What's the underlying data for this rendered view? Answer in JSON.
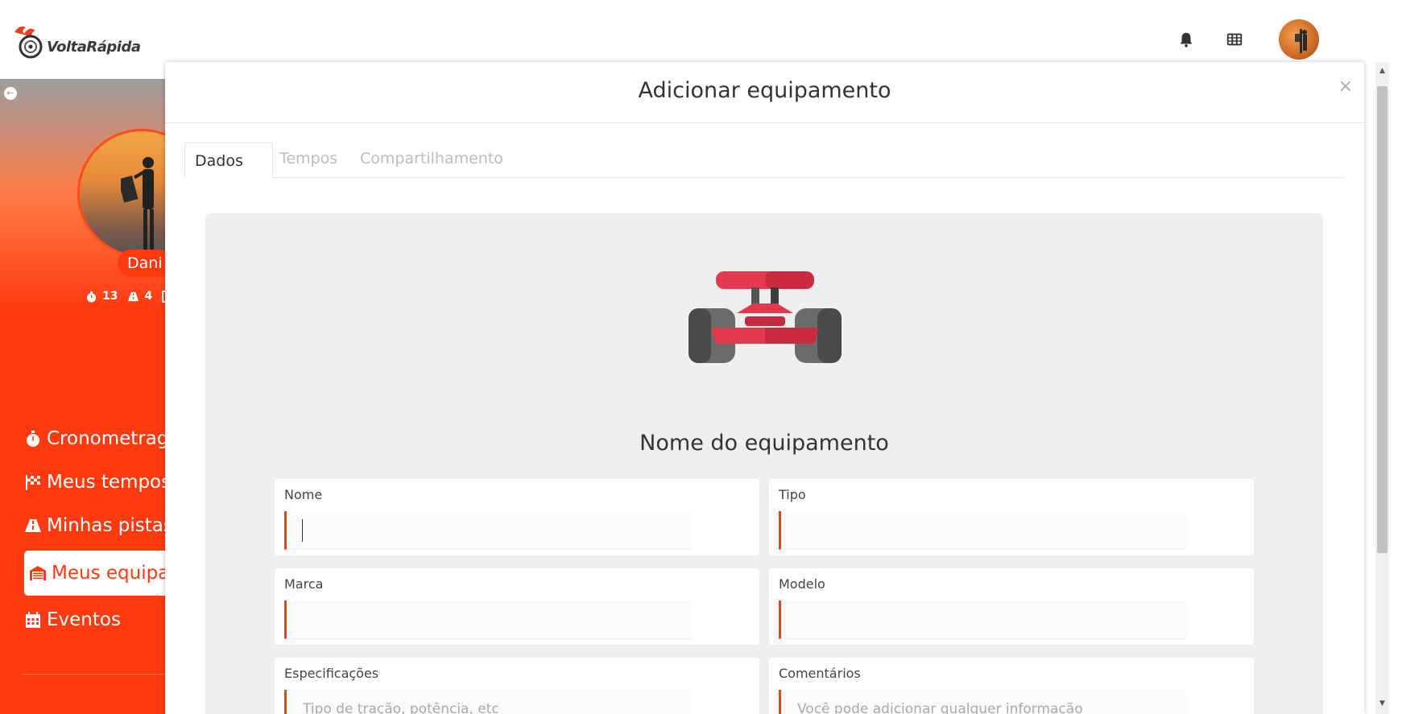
{
  "header": {
    "logo_text": "VoltaRápida",
    "bell_icon": "bell-icon",
    "apps_icon": "grid-icon"
  },
  "sidebar": {
    "user_name": "Dani",
    "stats": [
      {
        "icon": "stopwatch-icon",
        "value": "13"
      },
      {
        "icon": "road-icon",
        "value": "4"
      }
    ],
    "items": [
      {
        "label": "Cronometragem",
        "icon": "stopwatch-icon"
      },
      {
        "label": "Meus tempos",
        "icon": "checkered-flag-icon"
      },
      {
        "label": "Minhas pistas",
        "icon": "road-icon"
      },
      {
        "label": "Meus equipamentos",
        "icon": "garage-icon",
        "active": true
      },
      {
        "label": "Eventos",
        "icon": "calendar-icon"
      }
    ]
  },
  "modal": {
    "title": "Adicionar equipamento",
    "close": "×",
    "tabs": [
      {
        "label": "Dados",
        "active": true
      },
      {
        "label": "Tempos"
      },
      {
        "label": "Compartilhamento"
      }
    ],
    "section_title": "Nome do equipamento",
    "fields": {
      "nome": {
        "label": "Nome",
        "value": "",
        "placeholder": ""
      },
      "tipo": {
        "label": "Tipo",
        "value": "",
        "placeholder": ""
      },
      "marca": {
        "label": "Marca",
        "value": "",
        "placeholder": ""
      },
      "modelo": {
        "label": "Modelo",
        "value": "",
        "placeholder": ""
      },
      "especificacoes": {
        "label": "Especificações",
        "value": "",
        "placeholder": "Tipo de tração, potência, etc"
      },
      "comentarios": {
        "label": "Comentários",
        "value": "",
        "placeholder": "Você pode adicionar qualquer informação"
      }
    }
  },
  "colors": {
    "accent": "#ff3a10",
    "input_border": "#e8401c",
    "panel_bg": "#efefef"
  }
}
